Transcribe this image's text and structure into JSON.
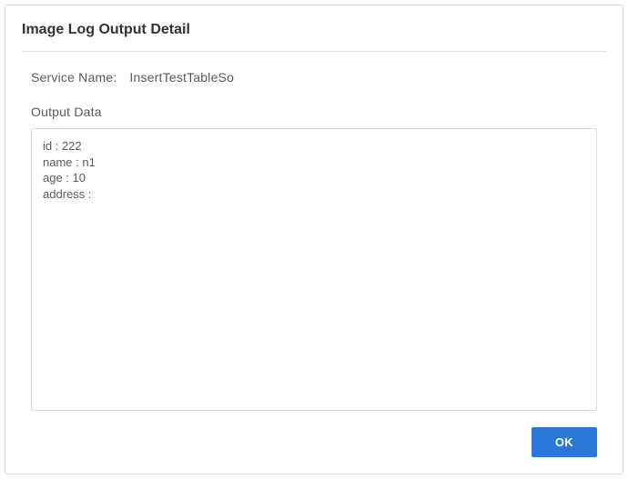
{
  "header": {
    "title": "Image  Log  Output  Detail"
  },
  "fields": {
    "service_name_label": "Service  Name:",
    "service_name_value": "InsertTestTableSo"
  },
  "output": {
    "section_label": "Output  Data",
    "content": "id : 222\nname : n1\nage : 10\naddress :"
  },
  "buttons": {
    "ok_label": "OK"
  }
}
